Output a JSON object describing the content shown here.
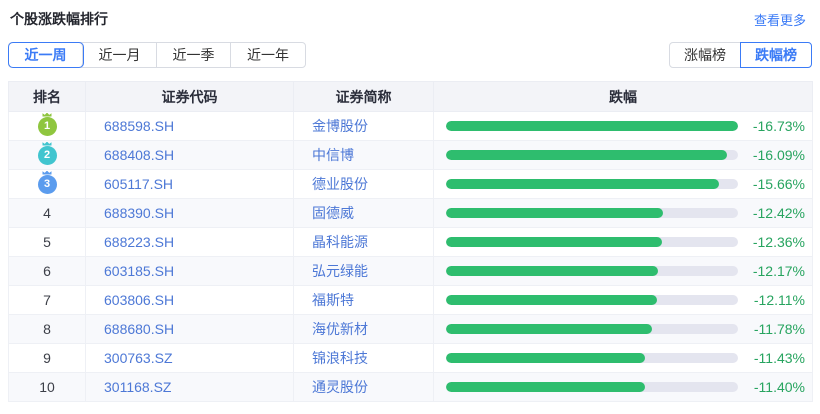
{
  "header": {
    "title": "个股涨跌幅排行",
    "more": "查看更多"
  },
  "period_tabs": [
    {
      "label": "近一周",
      "active": true
    },
    {
      "label": "近一月",
      "active": false
    },
    {
      "label": "近一季",
      "active": false
    },
    {
      "label": "近一年",
      "active": false
    }
  ],
  "board_toggle": [
    {
      "label": "涨幅榜",
      "active": false
    },
    {
      "label": "跌幅榜",
      "active": true
    }
  ],
  "table": {
    "headers": [
      "排名",
      "证券代码",
      "证券简称",
      "跌幅"
    ],
    "rows": [
      {
        "rank": "1",
        "code": "688598.SH",
        "name": "金博股份",
        "value": "-16.73%",
        "pct": -16.73
      },
      {
        "rank": "2",
        "code": "688408.SH",
        "name": "中信博",
        "value": "-16.09%",
        "pct": -16.09
      },
      {
        "rank": "3",
        "code": "605117.SH",
        "name": "德业股份",
        "value": "-15.66%",
        "pct": -15.66
      },
      {
        "rank": "4",
        "code": "688390.SH",
        "name": "固德威",
        "value": "-12.42%",
        "pct": -12.42
      },
      {
        "rank": "5",
        "code": "688223.SH",
        "name": "晶科能源",
        "value": "-12.36%",
        "pct": -12.36
      },
      {
        "rank": "6",
        "code": "603185.SH",
        "name": "弘元绿能",
        "value": "-12.17%",
        "pct": -12.17
      },
      {
        "rank": "7",
        "code": "603806.SH",
        "name": "福斯特",
        "value": "-12.11%",
        "pct": -12.11
      },
      {
        "rank": "8",
        "code": "688680.SH",
        "name": "海优新材",
        "value": "-11.78%",
        "pct": -11.78
      },
      {
        "rank": "9",
        "code": "300763.SZ",
        "name": "锦浪科技",
        "value": "-11.43%",
        "pct": -11.43
      },
      {
        "rank": "10",
        "code": "301168.SZ",
        "name": "通灵股份",
        "value": "-11.40%",
        "pct": -11.4
      }
    ]
  },
  "colors": {
    "accent_blue": "#3b7bf6",
    "link_blue": "#4d78d6",
    "bar_green": "#2ebd6e",
    "value_green": "#27a45f",
    "medal_1": "#8fc63f",
    "medal_2": "#41c5cf",
    "medal_3": "#5b9cee"
  }
}
